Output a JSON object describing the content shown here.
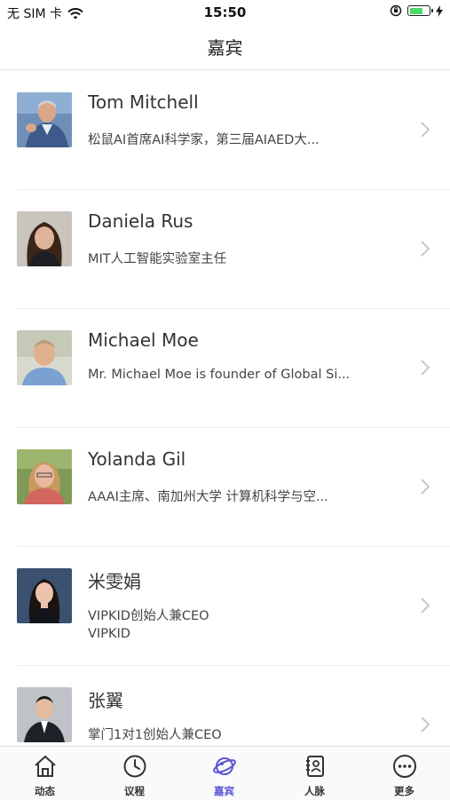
{
  "status_bar": {
    "carrier": "无 SIM 卡",
    "time": "15:50",
    "battery_level": 0.7,
    "battery_color": "#4cd964"
  },
  "header": {
    "title": "嘉宾"
  },
  "guests": [
    {
      "name": "Tom Mitchell",
      "description": "松鼠AI首席AI科学家，第三届AIAED大...",
      "company": ""
    },
    {
      "name": "Daniela Rus",
      "description": "MIT人工智能实验室主任",
      "company": ""
    },
    {
      "name": "Michael Moe",
      "description": "Mr. Michael Moe is founder of Global Si...",
      "company": ""
    },
    {
      "name": "Yolanda Gil",
      "description": "AAAI主席、南加州大学 计算机科学与空...",
      "company": ""
    },
    {
      "name": "米雯娟",
      "description": "VIPKID创始人兼CEO",
      "company": "VIPKID"
    },
    {
      "name": "张翼",
      "description": "掌门1对1创始人兼CEO",
      "company": ""
    }
  ],
  "tabs": [
    {
      "label": "动态",
      "icon": "home-icon"
    },
    {
      "label": "议程",
      "icon": "clock-icon"
    },
    {
      "label": "嘉宾",
      "icon": "planet-icon",
      "active": true
    },
    {
      "label": "人脉",
      "icon": "contacts-icon"
    },
    {
      "label": "更多",
      "icon": "more-icon"
    }
  ],
  "colors": {
    "accent": "#5a55d6",
    "chevron": "#c7c7cc"
  }
}
